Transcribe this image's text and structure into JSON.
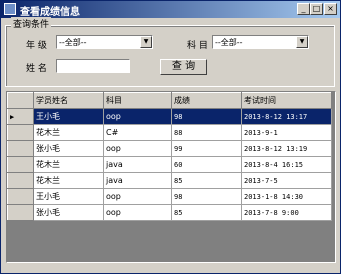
{
  "window": {
    "title": "查看成绩信息",
    "minimize": "_",
    "maximize": "□",
    "close": "×"
  },
  "query": {
    "group_title": "查询条件",
    "grade_label": "年  级",
    "grade_value": "--全部--",
    "subject_label": "科  目",
    "subject_value": "--全部--",
    "name_label": "姓  名",
    "name_value": "",
    "search_button": "查 询"
  },
  "grid": {
    "columns": [
      "学员姓名",
      "科目",
      "成绩",
      "考试时间"
    ],
    "rows": [
      [
        "王小毛",
        "oop",
        "98",
        "2013-8-12 13:17"
      ],
      [
        "花木兰",
        "C#",
        "88",
        "2013-9-1"
      ],
      [
        "张小毛",
        "oop",
        "99",
        "2013-8-12 13:19"
      ],
      [
        "花木兰",
        "java",
        "60",
        "2013-8-4 16:15"
      ],
      [
        "花木兰",
        "java",
        "85",
        "2013-7-5"
      ],
      [
        "王小毛",
        "oop",
        "98",
        "2013-1-8 14:30"
      ],
      [
        "张小毛",
        "oop",
        "85",
        "2013-7-8 9:00"
      ]
    ],
    "selected_row": 0,
    "row_marker": "▶"
  }
}
